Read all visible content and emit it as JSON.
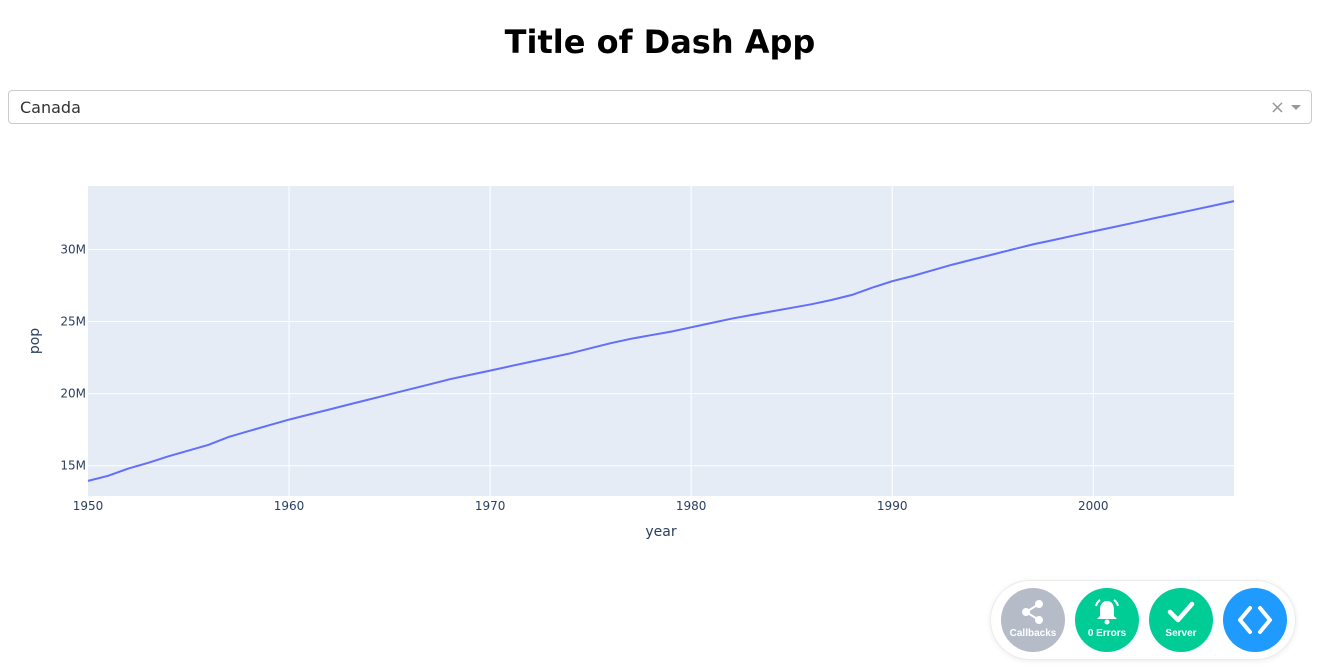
{
  "page": {
    "title": "Title of Dash App"
  },
  "dropdown": {
    "selected": "Canada",
    "clear_glyph": "×"
  },
  "chart_data": {
    "type": "line",
    "xlabel": "year",
    "ylabel": "pop",
    "xlim": [
      1950,
      2007
    ],
    "ylim": [
      12900000,
      34400000
    ],
    "x_ticks": [
      1950,
      1960,
      1970,
      1980,
      1990,
      2000
    ],
    "y_ticks": [
      15000000,
      20000000,
      25000000,
      30000000
    ],
    "y_tick_labels": [
      "15M",
      "20M",
      "25M",
      "30M"
    ],
    "grid": true,
    "line_color": "#636efa",
    "plot_bg": "#e5ecf6",
    "series": [
      {
        "x": [
          1950,
          1951,
          1952,
          1953,
          1954,
          1955,
          1956,
          1957,
          1958,
          1959,
          1960,
          1961,
          1962,
          1963,
          1964,
          1965,
          1966,
          1967,
          1968,
          1969,
          1970,
          1971,
          1972,
          1973,
          1974,
          1975,
          1976,
          1977,
          1978,
          1979,
          1980,
          1981,
          1982,
          1983,
          1984,
          1985,
          1986,
          1987,
          1988,
          1989,
          1990,
          1991,
          1992,
          1993,
          1994,
          1995,
          1996,
          1997,
          1998,
          1999,
          2000,
          2001,
          2002,
          2003,
          2004,
          2005,
          2006,
          2007
        ],
        "values": [
          13950000,
          14300000,
          14800000,
          15200000,
          15650000,
          16050000,
          16450000,
          17000000,
          17400000,
          17800000,
          18200000,
          18550000,
          18900000,
          19250000,
          19600000,
          19950000,
          20300000,
          20650000,
          21000000,
          21300000,
          21600000,
          21900000,
          22200000,
          22500000,
          22800000,
          23150000,
          23500000,
          23800000,
          24050000,
          24300000,
          24600000,
          24900000,
          25200000,
          25450000,
          25700000,
          25950000,
          26200000,
          26500000,
          26850000,
          27350000,
          27800000,
          28150000,
          28550000,
          28950000,
          29300000,
          29650000,
          30000000,
          30350000,
          30650000,
          30950000,
          31250000,
          31550000,
          31850000,
          32150000,
          32450000,
          32750000,
          33050000,
          33350000
        ]
      }
    ]
  },
  "devtools": {
    "callbacks_label": "Callbacks",
    "errors_label": "0 Errors",
    "server_label": "Server",
    "colors": {
      "callbacks": "#b5bcc8",
      "errors": "#00cc96",
      "server": "#00cc96",
      "toggle": "#1f9bff"
    }
  }
}
